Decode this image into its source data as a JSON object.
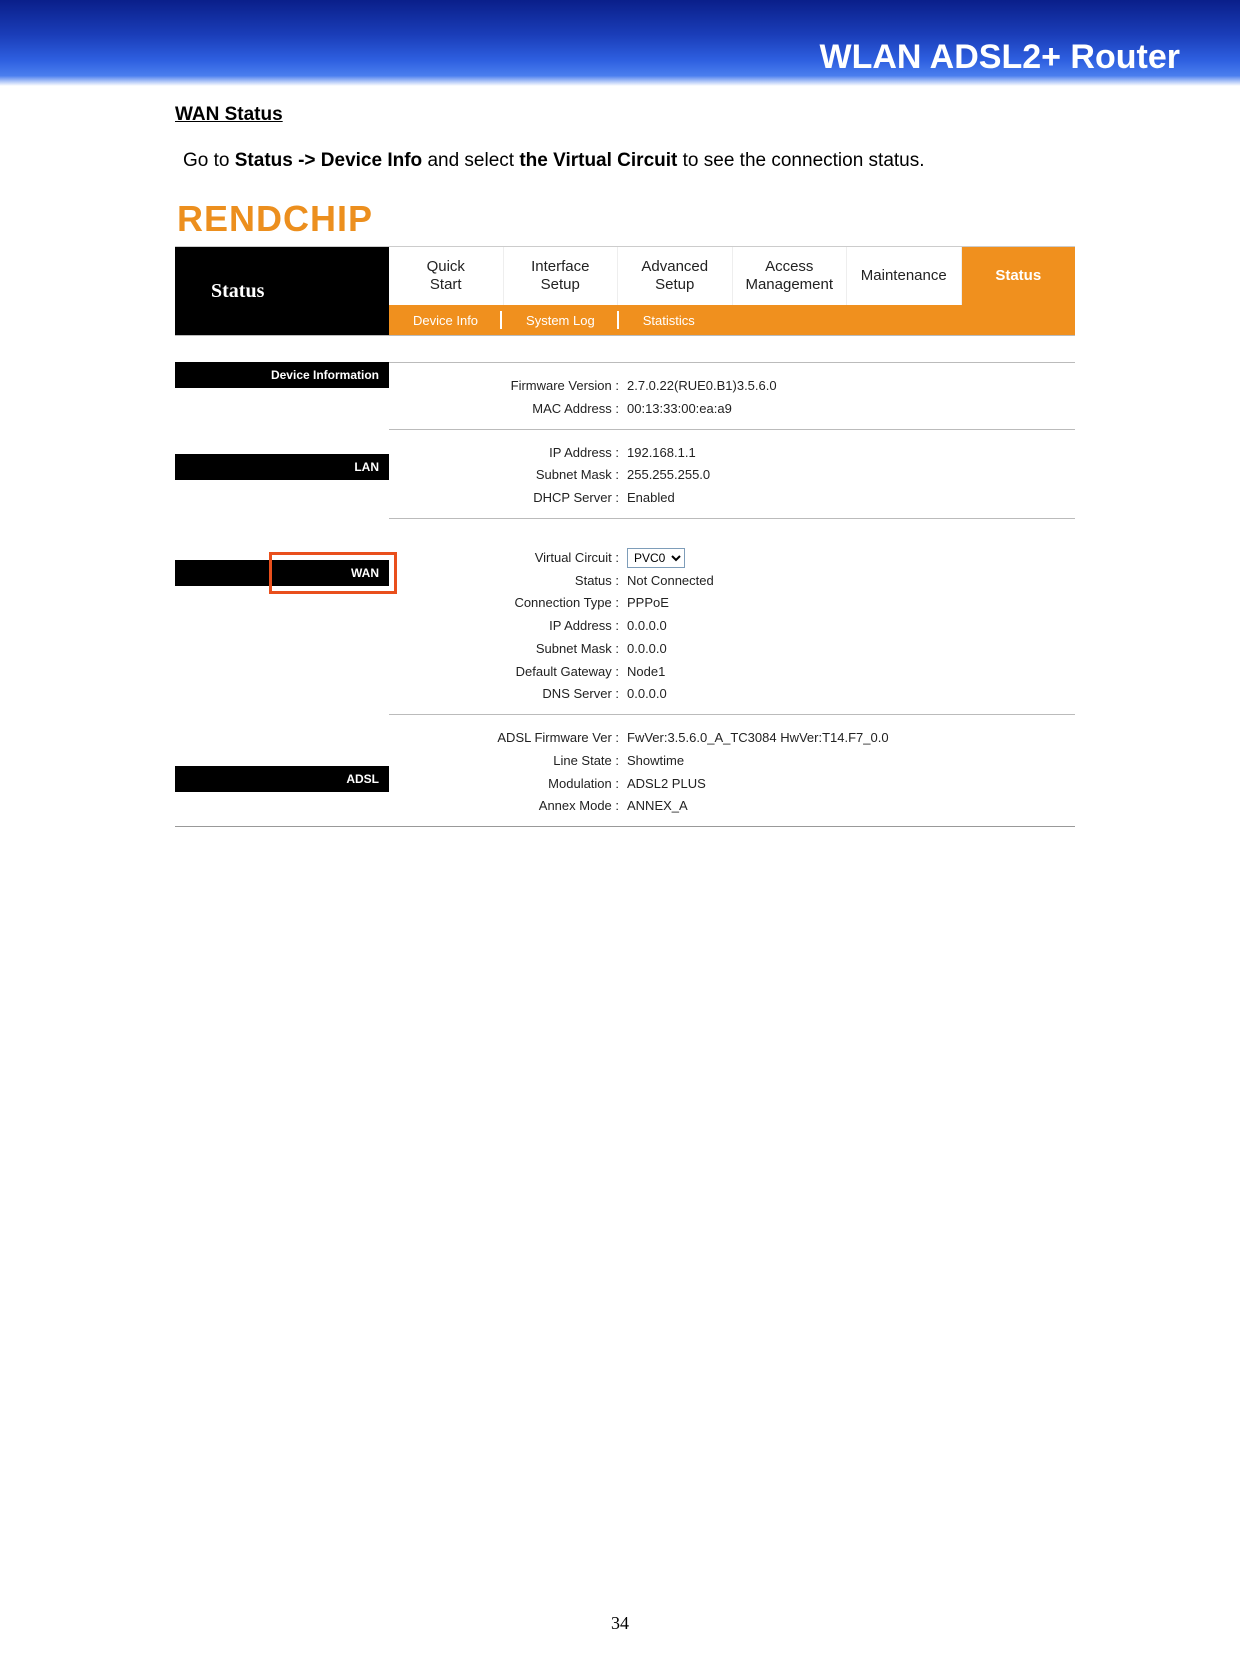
{
  "banner": {
    "title": "WLAN ADSL2+ Router"
  },
  "doc": {
    "section_heading": "WAN Status",
    "instruction_pre": "Go to ",
    "instruction_nav": "Status -> Device Info",
    "instruction_mid": " and select ",
    "instruction_select": "the Virtual Circuit",
    "instruction_post": " to see the connection status.",
    "page_number": "34"
  },
  "logo": "RENDCHIP",
  "tabs": {
    "left_label": "Status",
    "main": [
      {
        "label": "Quick\nStart"
      },
      {
        "label": "Interface\nSetup"
      },
      {
        "label": "Advanced\nSetup"
      },
      {
        "label": "Access\nManagement"
      },
      {
        "label": "Maintenance"
      },
      {
        "label": "Status",
        "active": true
      }
    ],
    "sub": [
      {
        "label": "Device Info"
      },
      {
        "label": "System Log"
      },
      {
        "label": "Statistics"
      }
    ]
  },
  "sections": {
    "device_info": {
      "title": "Device Information",
      "firmware_label": "Firmware Version :",
      "firmware_value": "2.7.0.22(RUE0.B1)3.5.6.0",
      "mac_label": "MAC Address :",
      "mac_value": "00:13:33:00:ea:a9"
    },
    "lan": {
      "title": "LAN",
      "ip_label": "IP Address :",
      "ip_value": "192.168.1.1",
      "mask_label": "Subnet Mask :",
      "mask_value": "255.255.255.0",
      "dhcp_label": "DHCP Server :",
      "dhcp_value": "Enabled"
    },
    "wan": {
      "title": "WAN",
      "vc_label": "Virtual Circuit :",
      "vc_value": "PVC0",
      "status_label": "Status :",
      "status_value": "Not Connected",
      "conn_label": "Connection Type :",
      "conn_value": "PPPoE",
      "ip_label": "IP Address :",
      "ip_value": "0.0.0.0",
      "mask_label": "Subnet Mask :",
      "mask_value": "0.0.0.0",
      "gw_label": "Default Gateway :",
      "gw_value": "Node1",
      "dns_label": "DNS Server :",
      "dns_value": "0.0.0.0"
    },
    "adsl": {
      "title": "ADSL",
      "fw_label": "ADSL Firmware Ver :",
      "fw_value": "FwVer:3.5.6.0_A_TC3084 HwVer:T14.F7_0.0",
      "line_label": "Line State :",
      "line_value": "Showtime",
      "mod_label": "Modulation :",
      "mod_value": "ADSL2 PLUS",
      "annex_label": "Annex Mode :",
      "annex_value": "ANNEX_A"
    }
  }
}
